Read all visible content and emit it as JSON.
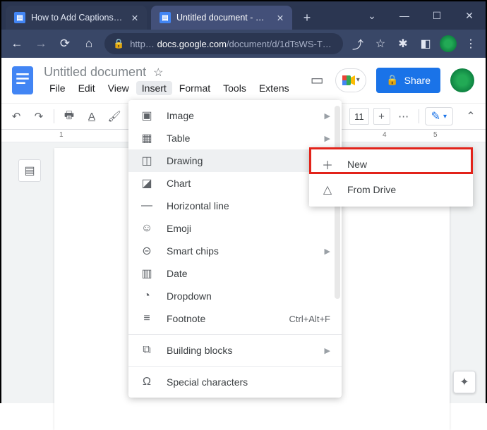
{
  "browser": {
    "tabs": [
      {
        "label": "How to Add Captions to Im…"
      },
      {
        "label": "Untitled document - Google…"
      }
    ],
    "url_host": "docs.google.com",
    "url_rest": "/document/d/1dTsWS-Tk…",
    "url_prefix": "https://"
  },
  "docs": {
    "title": "Untitled document",
    "menus": [
      "File",
      "Edit",
      "View",
      "Insert",
      "Format",
      "Tools",
      "Extens"
    ],
    "share_label": "Share"
  },
  "toolbar": {
    "zoom": "11"
  },
  "ruler": {
    "t1": "1",
    "t4": "4",
    "t5": "5"
  },
  "insert_menu": {
    "items": [
      {
        "label": "Image",
        "sub": true
      },
      {
        "label": "Table",
        "sub": true
      },
      {
        "label": "Drawing",
        "sub": true,
        "hover": true
      },
      {
        "label": "Chart",
        "sub": true
      },
      {
        "label": "Horizontal line"
      },
      {
        "label": "Emoji"
      },
      {
        "label": "Smart chips",
        "sub": true
      },
      {
        "label": "Date"
      },
      {
        "label": "Dropdown"
      },
      {
        "label": "Footnote",
        "shortcut": "Ctrl+Alt+F"
      },
      {
        "label": "Building blocks",
        "sub": true
      },
      {
        "label": "Special characters"
      }
    ]
  },
  "drawing_submenu": {
    "new_label": "New",
    "drive_label": "From Drive"
  }
}
